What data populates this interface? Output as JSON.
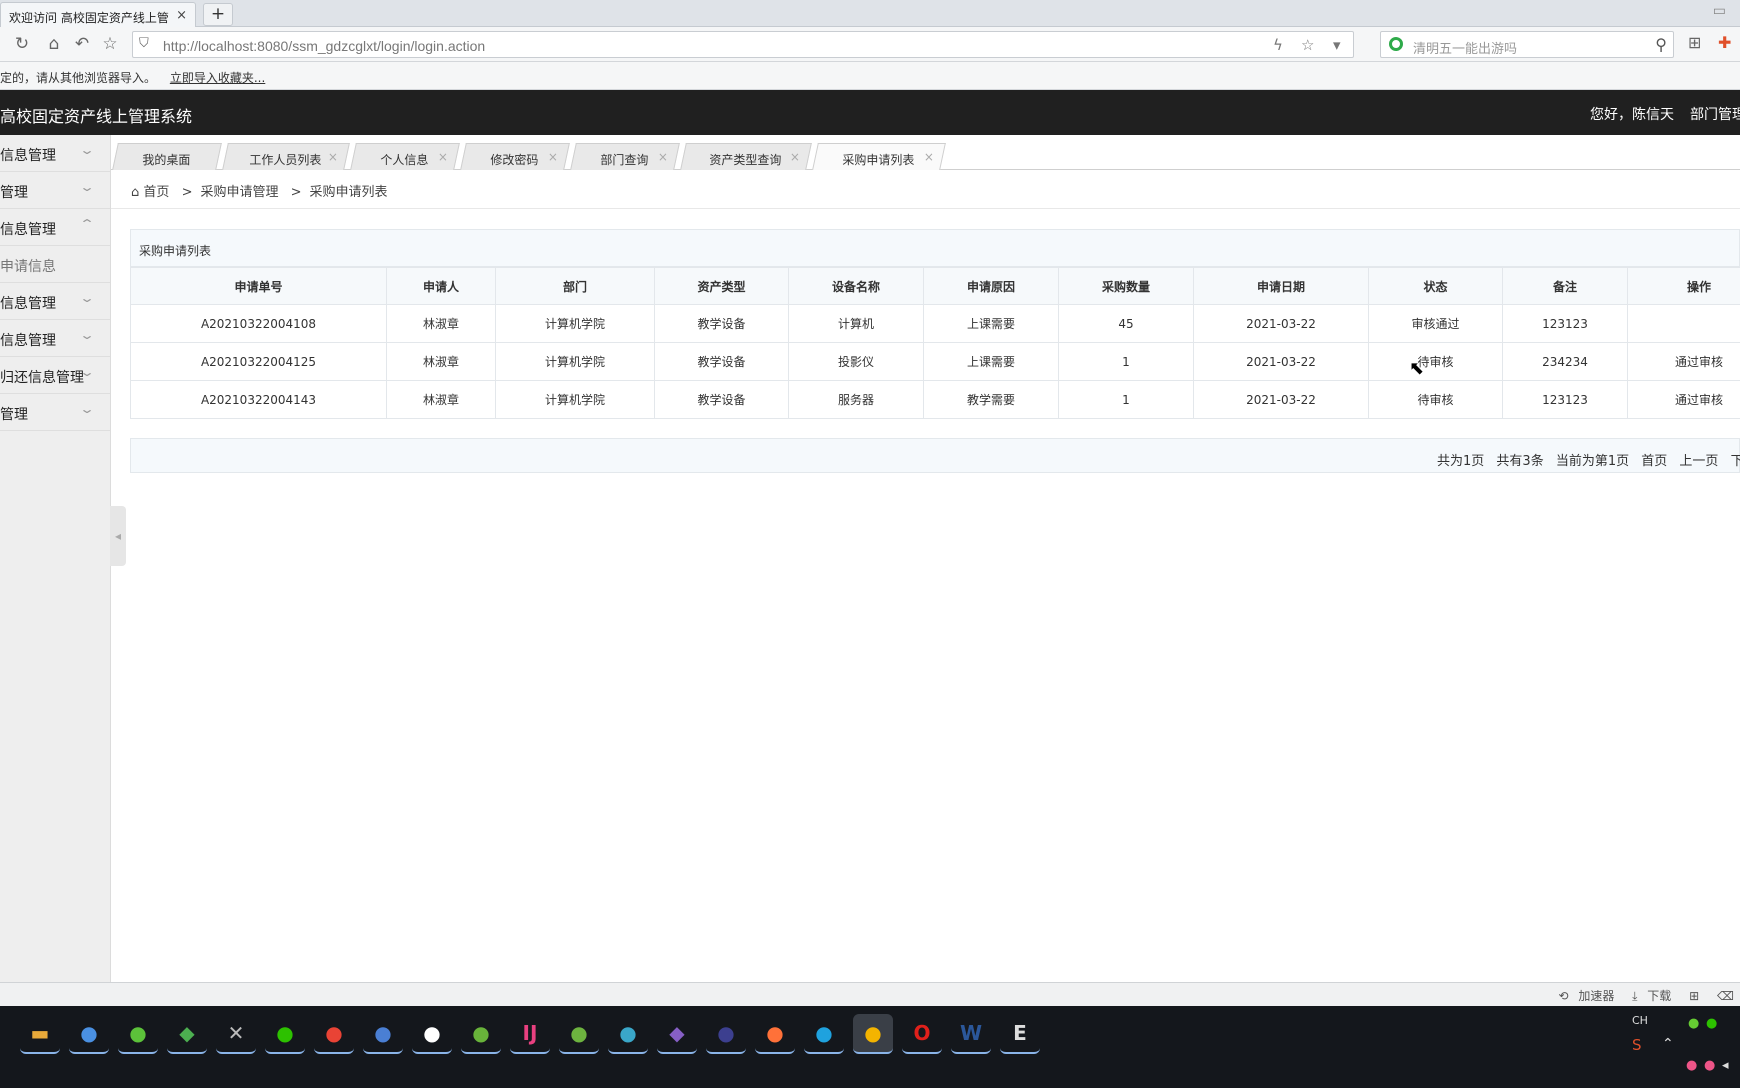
{
  "browser": {
    "tab_title": "欢迎访问 高校固定资产线上管",
    "tab_close": "×",
    "new_tab": "+",
    "url": "http://localhost:8080/ssm_gdzcglxt/login/login.action",
    "search_placeholder": "清明五一能出游吗",
    "bookmark_notice": "定的，请从其他浏览器导入。",
    "bookmark_link": "立即导入收藏夹..."
  },
  "header": {
    "title": "高校固定资产线上管理系统",
    "greeting": "您好，陈信天",
    "role": "部门管理"
  },
  "sidebar": {
    "items": [
      {
        "label": "信息管理",
        "chevron": "⌄"
      },
      {
        "label": "管理",
        "chevron": "⌄"
      },
      {
        "label": "信息管理",
        "chevron": "⌃"
      },
      {
        "label": "申请信息",
        "chevron": ""
      },
      {
        "label": "信息管理",
        "chevron": "⌄"
      },
      {
        "label": "信息管理",
        "chevron": "⌄"
      },
      {
        "label": "归还信息管理",
        "chevron": "⌄"
      },
      {
        "label": "管理",
        "chevron": "⌄"
      }
    ]
  },
  "tabs": [
    {
      "label": "我的桌面"
    },
    {
      "label": "工作人员列表"
    },
    {
      "label": "个人信息"
    },
    {
      "label": "修改密码"
    },
    {
      "label": "部门查询"
    },
    {
      "label": "资产类型查询"
    },
    {
      "label": "采购申请列表"
    }
  ],
  "tab_close": "×",
  "breadcrumb": {
    "home": "首页",
    "sep": ">",
    "level1": "采购申请管理",
    "level2": "采购申请列表"
  },
  "panel_title": "采购申请列表",
  "table": {
    "headers": [
      "申请单号",
      "申请人",
      "部门",
      "资产类型",
      "设备名称",
      "申请原因",
      "采购数量",
      "申请日期",
      "状态",
      "备注",
      "操作"
    ],
    "rows": [
      [
        "A20210322004108",
        "林淑章",
        "计算机学院",
        "教学设备",
        "计算机",
        "上课需要",
        "45",
        "2021-03-22",
        "审核通过",
        "123123",
        ""
      ],
      [
        "A20210322004125",
        "林淑章",
        "计算机学院",
        "教学设备",
        "投影仪",
        "上课需要",
        "1",
        "2021-03-22",
        "待审核",
        "234234",
        "通过审核"
      ],
      [
        "A20210322004143",
        "林淑章",
        "计算机学院",
        "教学设备",
        "服务器",
        "教学需要",
        "1",
        "2021-03-22",
        "待审核",
        "123123",
        "通过审核"
      ]
    ]
  },
  "pager": {
    "total_pages": "共为1页",
    "total_items": "共有3条",
    "current": "当前为第1页",
    "first": "首页",
    "prev": "上一页",
    "next": "下"
  },
  "statusbar": {
    "accelerator": "加速器",
    "download": "下载"
  },
  "taskbar": {
    "lang": "CH",
    "apps": [
      {
        "icon": "file-explorer-icon",
        "glyph": "▬",
        "color": "#e8a93a"
      },
      {
        "icon": "globe-icon",
        "glyph": "●",
        "color": "#4a90e2"
      },
      {
        "icon": "360-browser-icon",
        "glyph": "●",
        "color": "#5cc23a"
      },
      {
        "icon": "database-tool-icon",
        "glyph": "◆",
        "color": "#4caf50"
      },
      {
        "icon": "tools-icon",
        "glyph": "✕",
        "color": "#bbbbbb"
      },
      {
        "icon": "wechat-icon",
        "glyph": "●",
        "color": "#2dc100"
      },
      {
        "icon": "chrome-icon",
        "glyph": "●",
        "color": "#e94335"
      },
      {
        "icon": "chromium-icon",
        "glyph": "●",
        "color": "#4a7fd4"
      },
      {
        "icon": "qq-icon",
        "glyph": "●",
        "color": "#ffffff"
      },
      {
        "icon": "leaf-app-icon",
        "glyph": "●",
        "color": "#68b33a"
      },
      {
        "icon": "intellij-icon",
        "glyph": "IJ",
        "color": "#e94080"
      },
      {
        "icon": "spring-icon",
        "glyph": "●",
        "color": "#6db33f"
      },
      {
        "icon": "mysql-icon",
        "glyph": "●",
        "color": "#3aa7c9"
      },
      {
        "icon": "visual-studio-icon",
        "glyph": "◆",
        "color": "#865fc5"
      },
      {
        "icon": "eclipse-icon",
        "glyph": "●",
        "color": "#3c3f8f"
      },
      {
        "icon": "firefox-icon",
        "glyph": "●",
        "color": "#ff7139"
      },
      {
        "icon": "edge-icon",
        "glyph": "●",
        "color": "#1fa2de"
      },
      {
        "icon": "speedbrowser-icon",
        "glyph": "●",
        "color": "#f4b400"
      },
      {
        "icon": "opera-icon",
        "glyph": "O",
        "color": "#e0201b"
      },
      {
        "icon": "word-icon",
        "glyph": "W",
        "color": "#2b579a"
      },
      {
        "icon": "editor-icon",
        "glyph": "E",
        "color": "#dddddd"
      }
    ]
  }
}
